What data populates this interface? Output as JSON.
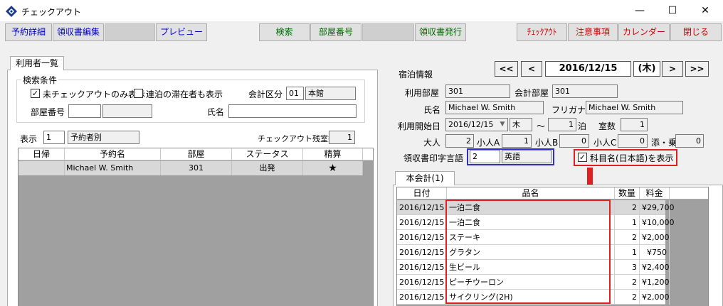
{
  "window": {
    "title": "チェックアウト",
    "minimize": "—",
    "maximize": "☐",
    "close": "✕"
  },
  "toolbar": {
    "reservation_detail": "予約詳細",
    "receipt_edit": "領収書編集",
    "preview": "プレビュー",
    "search": "検索",
    "room_number": "部屋番号",
    "receipt_issue": "領収書発行",
    "checkout": "ﾁｪｯｸｱｳﾄ",
    "notes": "注意事項",
    "calendar": "カレンダー",
    "close": "閉じる"
  },
  "left": {
    "tab": "利用者一覧",
    "search_group": "検索条件",
    "only_unchecked": {
      "label": "未チェックアウトのみ表示",
      "checked": true
    },
    "show_multi_night": {
      "label": "連泊の滞在者も表示",
      "checked": false
    },
    "account_division_label": "会計区分",
    "account_division_code": "01",
    "account_division_name": "本館",
    "room_number_label": "部屋番号",
    "room_number_value": "",
    "room_number_name": "",
    "guest_name_label": "氏名",
    "guest_name_value": "",
    "display_label": "表示",
    "display_code": "1",
    "display_name": "予約者別",
    "remaining_rooms_label": "チェックアウト残室数",
    "remaining_rooms_value": "1",
    "table": {
      "headers": [
        "日帰",
        "予約名",
        "部屋",
        "ステータス",
        "精算"
      ],
      "rows": [
        {
          "day_trip": "",
          "name": "Michael W. Smith",
          "room": "301",
          "status": "出発",
          "settled": "★"
        }
      ]
    }
  },
  "right": {
    "nav": {
      "prev_prev": "<<",
      "prev": "<",
      "date": "2016/12/15",
      "weekday": "(木)",
      "next": ">",
      "next_next": ">>"
    },
    "stay_info_label": "宿泊情報",
    "room_label": "利用部屋",
    "room_value": "301",
    "account_room_label": "会計部屋",
    "account_room_value": "301",
    "name_label": "氏名",
    "name_value": "Michael W. Smith",
    "furigana_label": "フリガナ",
    "furigana_value": "Michael W. Smith",
    "start_date_label": "利用開始日",
    "start_date_value": "2016/12/15",
    "start_weekday": "木",
    "tilde": "〜",
    "nights_value": "1",
    "nights_label": "泊",
    "rooms_label": "室数",
    "rooms_value": "1",
    "adult_label": "大人",
    "adult_value": "2",
    "child_a_label": "小人A",
    "child_a_value": "1",
    "child_b_label": "小人B",
    "child_b_value": "0",
    "child_c_label": "小人C",
    "child_c_value": "0",
    "cosleep_label": "添・乗",
    "cosleep_value": "0",
    "receipt_lang_label": "領収書印字言語",
    "receipt_lang_code": "2",
    "receipt_lang_name": "英語",
    "show_japanese_items": {
      "label": "科目名(日本語)を表示",
      "checked": true
    },
    "bill_tab": "本会計(1)",
    "bill": {
      "headers": [
        "日付",
        "品名",
        "数量",
        "料金"
      ],
      "rows": [
        {
          "date": "2016/12/15",
          "item": "一泊二食",
          "qty": "2",
          "amount": "¥29,700"
        },
        {
          "date": "2016/12/15",
          "item": "一泊二食",
          "qty": "1",
          "amount": "¥10,000"
        },
        {
          "date": "2016/12/15",
          "item": "ステーキ",
          "qty": "2",
          "amount": "¥2,000"
        },
        {
          "date": "2016/12/15",
          "item": "グラタン",
          "qty": "1",
          "amount": "¥750"
        },
        {
          "date": "2016/12/15",
          "item": "生ビール",
          "qty": "3",
          "amount": "¥2,400"
        },
        {
          "date": "2016/12/15",
          "item": "ピーチウーロン",
          "qty": "2",
          "amount": "¥1,200"
        },
        {
          "date": "2016/12/15",
          "item": "サイクリング(2H)",
          "qty": "2",
          "amount": "¥2,000"
        }
      ]
    }
  },
  "colors": {
    "highlight_red": "#e02020",
    "highlight_blue": "#3030c0"
  }
}
